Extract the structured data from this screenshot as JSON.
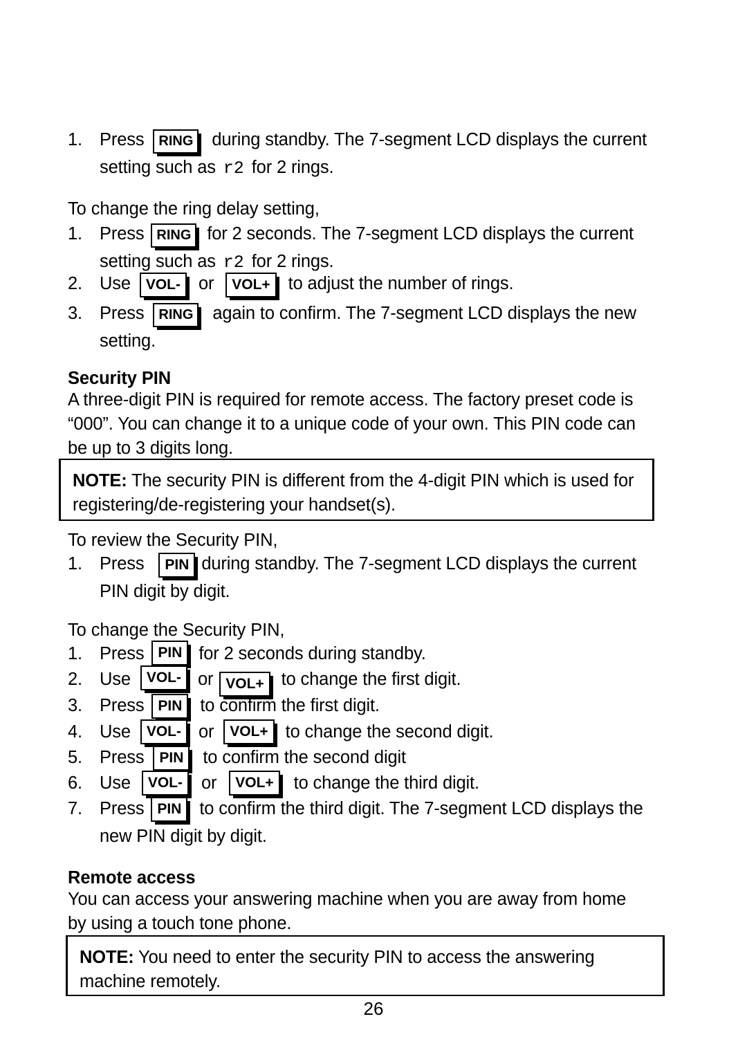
{
  "document": {
    "page_number": "26"
  },
  "section_ring": {
    "item1": {
      "number": "1.",
      "text_before_key": "Press",
      "key": "RING",
      "text_after_key": "during standby. The 7-segment LCD displays the current",
      "line2_before_code": "setting such as",
      "code": "r2",
      "line2_after_code": "for 2 rings."
    },
    "intro": "To change the ring delay setting,",
    "item2": {
      "number": "1.",
      "text_before_key": "Press",
      "key": "RING",
      "text_after_key": "for 2 seconds. The 7-segment LCD displays the current",
      "line2_before_code": "setting such as",
      "code": "r2",
      "line2_after_code": "for 2 rings."
    },
    "item3": {
      "number": "2.",
      "text_before_key": "Use",
      "key_minus": "VOL-",
      "conjunction": "or",
      "key_plus": "VOL+",
      "text_after_key": "to adjust the number of rings."
    },
    "item4": {
      "number": "3.",
      "text_before_key": "Press",
      "key": "RING",
      "text_after_key": "again to confirm. The 7-segment LCD displays the new",
      "line2": "setting."
    }
  },
  "security_pin": {
    "heading": "Security PIN",
    "body_line1": "A three-digit PIN is required for remote access. The factory preset code is",
    "body_line2": "“000”. You can change it to a unique code of your own. This PIN code can",
    "body_line3": "be up to 3 digits long.",
    "note": {
      "label": "NOTE:",
      "line1": " The security PIN is different from the 4-digit PIN which is used for",
      "line2": "registering/de-registering your handset(s)."
    },
    "review_intro": "To review the Security PIN,",
    "review_item1": {
      "number": "1.",
      "text_before_key": "Press",
      "key": "PIN",
      "text_after_key": "during standby. The 7-segment LCD displays the current",
      "line2": "PIN digit by digit."
    },
    "change_intro": "To change the Security PIN,",
    "change_steps": [
      {
        "number": "1.",
        "verb": "Press",
        "key": "PIN",
        "tail": "for 2 seconds during standby."
      },
      {
        "number": "2.",
        "verb": "Use",
        "key_minus": "VOL-",
        "conjunction": "or",
        "key_plus": "VOL+",
        "tail": "to change the first digit."
      },
      {
        "number": "3.",
        "verb": "Press",
        "key": "PIN",
        "tail": "to confirm the first digit."
      },
      {
        "number": "4.",
        "verb": "Use",
        "key_minus": "VOL-",
        "conjunction": "or",
        "key_plus": "VOL+",
        "tail": "to change the second digit."
      },
      {
        "number": "5.",
        "verb": "Press",
        "key": "PIN",
        "tail": "to confirm the second digit"
      },
      {
        "number": "6.",
        "verb": "Use",
        "key_minus": "VOL-",
        "conjunction": "or",
        "key_plus": "VOL+",
        "tail": "to change the third digit."
      },
      {
        "number": "7.",
        "verb": "Press",
        "key": "PIN",
        "tail": "to confirm the third digit. The 7-segment LCD displays the",
        "tail_line2": "new PIN digit by digit."
      }
    ]
  },
  "remote_access": {
    "heading": "Remote access",
    "body_line1": "You can access your answering machine when you are away from home",
    "body_line2": "by using a touch tone phone.",
    "note": {
      "label": "NOTE:",
      "line1": " You need to enter the security PIN to access the answering",
      "line2": "machine remotely."
    }
  }
}
